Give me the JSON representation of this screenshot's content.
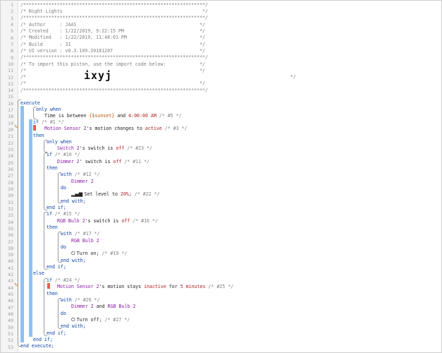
{
  "header": {
    "stars1": "/*****************************************************************/",
    "title": "/* Night Lights                                                  */",
    "stars2": "/*****************************************************************/",
    "author": "/* Author     : JAAS                                            */",
    "created": "/* Created    : 1/22/2019, 9:22:15 PM                           */",
    "modified": "/* Modified   : 1/22/2019, 11:48:01 PM                          */",
    "build": "/* Build      : 31                                              */",
    "ui": "/* UI version : v0.3.109.20181207                               */",
    "stars3": "/*****************************************************************/",
    "import": "/* To import this piston, use the import code below:            */",
    "blank1": "/*                                                              */",
    "code_pre": "/*              ",
    "import_code": "ixyj",
    "code_post": "                                         */",
    "blank2": "/*                                                              */",
    "stars4": "/*****************************************************************/"
  },
  "lines": {
    "execute": "execute",
    "only_when": "only when",
    "time_a": "Time is between ",
    "time_sunset": "{$sunset}",
    "time_b": " and ",
    "time_val": "4:00:00 AM",
    "time_c": " /* #5 */",
    "if1": "if",
    "if1_c": " /* #1 */",
    "ms1_dev": "Motion Sensor 2",
    "ms1_a": "'s motion changes to ",
    "ms1_val": "active",
    "ms1_c": " /* #3 */",
    "then1": "then",
    "only_when2": "only when",
    "sw_dev": "Switch 2",
    "sw_a": "'s switch is ",
    "sw_val": "off",
    "sw_c": " /* #23 */",
    "if10": "if",
    "if10_c": " /* #10 */",
    "dim_dev": "Dimmer 2",
    "dim_a": "' switch is ",
    "dim_val": "off",
    "dim_c": " /* #11 */",
    "then2": "then",
    "with12": "with",
    "with12_c": " /* #12 */",
    "with12_dev": "Dimmer 2",
    "do1": "do",
    "setlevel_a": "Set level to ",
    "setlevel_val": "20%",
    "setlevel_b": ";",
    "setlevel_c": " /* #22 */",
    "endwith1": "end with;",
    "endif1": "end if;",
    "if15": "if",
    "if15_c": " /* #15 */",
    "rgb_dev": "RGB Bulb 2",
    "rgb_a": "'s switch is ",
    "rgb_val": "off",
    "rgb_c": " /* #16 */",
    "then3": "then",
    "with17": "with",
    "with17_c": " /* #17 */",
    "with17_dev": "RGB Bulb 2",
    "do2": "do",
    "turnon": "Turn on;",
    "turnon_c": " /* #19 */",
    "endwith2": "end with;",
    "endif2": "end if;",
    "else": "else",
    "if24": "if",
    "if24_c": " /* #24 */",
    "ms2_dev": "Motion Sensor 2",
    "ms2_a": "'s motion stays ",
    "ms2_val": "inactive",
    "ms2_b": " for ",
    "ms2_val2": "5 minutes",
    "ms2_c": " /* #25 */",
    "then4": "then",
    "with26": "with",
    "with26_c": " /* #26 */",
    "with26_dev1": "Dimmer 2",
    "with26_and": " and ",
    "with26_dev2": "RGB Bulb 2",
    "do3": "do",
    "turnoff": "Turn off;",
    "turnoff_c": " /* #27 */",
    "endwith3": "end with;",
    "endif3": "end if;",
    "endif4": "end if;",
    "endexecute": "end execute;"
  },
  "icons": {
    "level": "signal-bars-icon",
    "power": "power-icon",
    "edit": "pencil-icon"
  },
  "colors": {
    "comment": "#808080",
    "keyword": "#0a3fa8",
    "device": "#8a1aa6",
    "value": "#b11c1c",
    "variable": "#c0550a",
    "bar": "#8fc2ee",
    "marker": "#e06050"
  }
}
